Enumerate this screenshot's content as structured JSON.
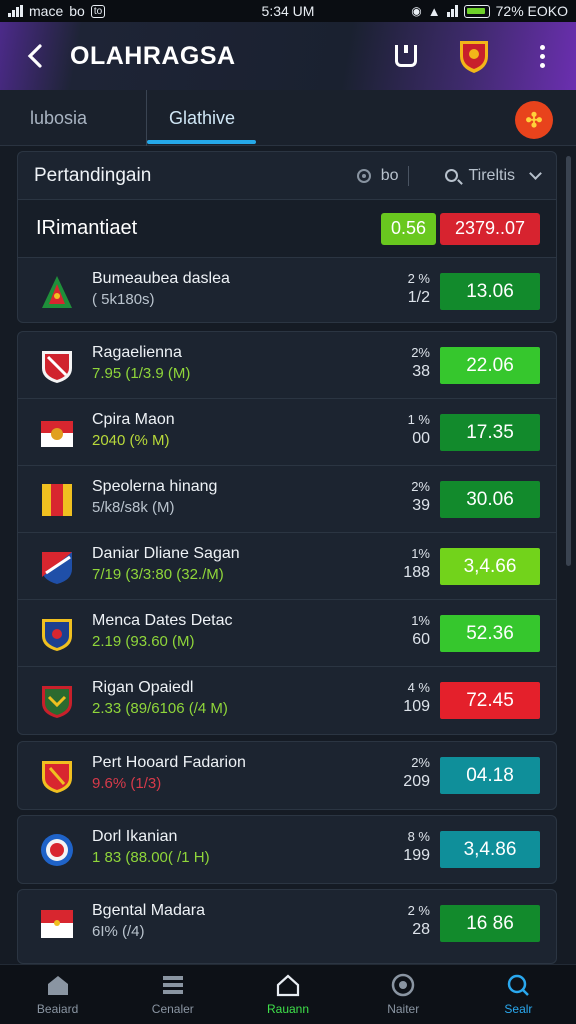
{
  "status": {
    "carrier": "mace",
    "app1": "bo",
    "app2": "to",
    "time": "5:34 UM",
    "battery": "72% EOKO"
  },
  "app_bar": {
    "title": "OLAHRAGSA"
  },
  "tabs": [
    {
      "label": "lubosia"
    },
    {
      "label": "Glathive"
    }
  ],
  "filter": {
    "title": "Pertandingain",
    "option": "bo",
    "sort_label": "Tireltis"
  },
  "summary": {
    "label": "IRimantiaet",
    "green_value": "0.56",
    "red_value": "2379..07"
  },
  "colors": {
    "green_dark": "#128a2c",
    "green_light": "#36c72d",
    "lime": "#72d31b",
    "red": "#e4202b",
    "teal": "#0f8f9a"
  },
  "matches": [
    {
      "name": "Bumeaubea daslea",
      "sub": "( 5k180s)",
      "sub_color": "#b9c3cd",
      "pct": "2 %",
      "count": "1/2",
      "odds": "13.06",
      "odds_color": "#128a2c",
      "crest": "triangle-crest-icon"
    },
    {
      "name": "Ragaelienna",
      "sub": "7.95 (1/3.9 (M)",
      "sub_color": "#8fd63a",
      "pct": "2%",
      "count": "38",
      "odds": "22.06",
      "odds_color": "#36c72d",
      "crest": "red-shield-icon"
    },
    {
      "name": "Cpira Maon",
      "sub": "2040 (% M)",
      "sub_color": "#b8d93a",
      "pct": "1 %",
      "count": "00",
      "odds": "17.35",
      "odds_color": "#128a2c",
      "crest": "lion-flag-icon"
    },
    {
      "name": "Speolerna hinang",
      "sub": "5/k8/s8k (M)",
      "sub_color": "#b9c3cd",
      "pct": "2%",
      "count": "39",
      "odds": "30.06",
      "odds_color": "#128a2c",
      "crest": "stripe-flag-icon"
    },
    {
      "name": "Daniar Dliane Sagan",
      "sub": "7/19 (3/3:80 (32./M)",
      "sub_color": "#8fd63a",
      "pct": "1%",
      "count": "188",
      "odds": "3,4.66",
      "odds_color": "#72d31b",
      "crest": "blue-red-shield-icon"
    },
    {
      "name": "Menca Dates Detac",
      "sub": "2.19 (93.60 (M)",
      "sub_color": "#8fd63a",
      "pct": "1%",
      "count": "60",
      "odds": "52.36",
      "odds_color": "#36c72d",
      "crest": "navy-shield-icon"
    },
    {
      "name": "Rigan Opaiedl",
      "sub": "2.33 (89/6106 (/4 M)",
      "sub_color": "#8fd63a",
      "pct": "4 %",
      "count": "109",
      "odds": "72.45",
      "odds_color": "#e4202b",
      "crest": "eagle-shield-icon"
    },
    {
      "name": "Pert Hooard Fadarion",
      "sub": "9.6% (1/3)",
      "sub_color": "#d63a4a",
      "pct": "2%",
      "count": "209",
      "odds": "04.18",
      "odds_color": "#0f8f9a",
      "crest": "red-gold-shield-icon"
    },
    {
      "name": "Dorl Ikanian",
      "sub": "1 83 (88.00( /1 H)",
      "sub_color": "#8fd63a",
      "pct": "8 %",
      "count": "199",
      "odds": "3,4.86",
      "odds_color": "#0f8f9a",
      "crest": "round-badge-icon"
    },
    {
      "name": "Bgental Madara",
      "sub": "6I% (/4)",
      "sub_color": "#b9c3cd",
      "pct": "2 %",
      "count": "28",
      "odds": "16 86",
      "odds_color": "#128a2c",
      "crest": "red-white-flag-icon"
    }
  ],
  "nav": [
    {
      "label": "Beaiard",
      "icon": "home-icon"
    },
    {
      "label": "Cenaler",
      "icon": "list-icon"
    },
    {
      "label": "Rauann",
      "icon": "house-outline-icon"
    },
    {
      "label": "Naiter",
      "icon": "target-icon"
    },
    {
      "label": "Sealr",
      "icon": "search-icon"
    }
  ]
}
